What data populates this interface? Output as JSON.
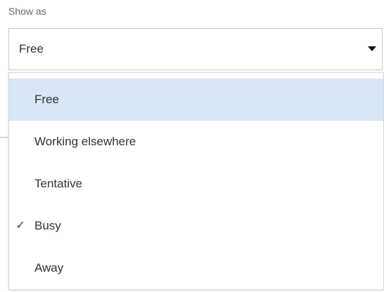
{
  "field": {
    "label": "Show as",
    "selected_value": "Free"
  },
  "dropdown": {
    "options": [
      {
        "label": "Free",
        "highlighted": true,
        "checked": false
      },
      {
        "label": "Working elsewhere",
        "highlighted": false,
        "checked": false
      },
      {
        "label": "Tentative",
        "highlighted": false,
        "checked": false
      },
      {
        "label": "Busy",
        "highlighted": false,
        "checked": true
      },
      {
        "label": "Away",
        "highlighted": false,
        "checked": false
      }
    ],
    "check_glyph": "✓"
  },
  "colors": {
    "highlight": "#d9e6f5",
    "border": "#c8c8c8",
    "text": "#333333",
    "label_text": "#666666"
  },
  "icons": {
    "dropdown_caret": "chevron-down-icon",
    "checkmark": "checkmark-icon"
  }
}
